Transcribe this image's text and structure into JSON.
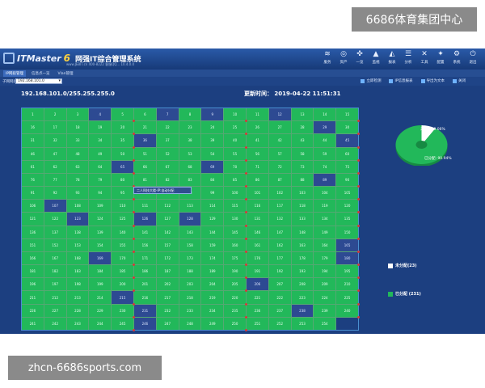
{
  "watermarks": {
    "top": "6686体育集团中心",
    "bottom": "zhcn-6686sports.com"
  },
  "app": {
    "brand": "ITMaster",
    "version": "6",
    "title": "网强IT综合管理系统",
    "subtitle": "www.JEBIT.cn   400-8222  客服QQ...  10.4.0.0"
  },
  "toolbar": [
    {
      "name": "server",
      "label": "服务",
      "icon": "server-icon",
      "glyph": "≋"
    },
    {
      "name": "assets",
      "label": "资产",
      "icon": "assets-icon",
      "glyph": "◎"
    },
    {
      "name": "topology",
      "label": "一览",
      "icon": "topology-icon",
      "glyph": "✜"
    },
    {
      "name": "monitor",
      "label": "监视",
      "icon": "monitor-icon",
      "glyph": "▲"
    },
    {
      "name": "chart",
      "label": "报表",
      "icon": "chart-icon",
      "glyph": "◭"
    },
    {
      "name": "analysis",
      "label": "分析",
      "icon": "analysis-icon",
      "glyph": "☰"
    },
    {
      "name": "tools",
      "label": "工具",
      "icon": "tools-icon",
      "glyph": "✕"
    },
    {
      "name": "settings",
      "label": "配置",
      "icon": "settings-icon",
      "glyph": "✦"
    },
    {
      "name": "system",
      "label": "系统",
      "icon": "system-icon",
      "glyph": "⚙"
    },
    {
      "name": "exit",
      "label": "退出",
      "icon": "exit-icon",
      "glyph": "⏻"
    }
  ],
  "tabs": [
    "IP网段管理",
    "信息点一览",
    "Vlan管理"
  ],
  "filter": {
    "label": "子网网段:",
    "value": "192.168.101.0"
  },
  "actions": [
    "立即检测",
    "IP信息报表",
    "导出为文本",
    "关闭"
  ],
  "subnet": "192.168.101.0/255.255.255.0",
  "update_time": "更新时间： 2019-04-22 11:51:31",
  "tooltip": "二人科技大楼-IP:自动分配",
  "grid": {
    "total": 254,
    "unused": [
      4,
      7,
      9,
      12,
      29,
      36,
      45,
      65,
      69,
      89,
      107,
      123,
      126,
      128,
      165,
      169,
      180,
      206,
      215,
      231,
      238,
      246
    ]
  },
  "chart_data": {
    "type": "pie",
    "categories": [
      "未分配",
      "已分配"
    ],
    "values": [
      23,
      231
    ],
    "labels": [
      "未分配: 9.06%",
      "已分配: 90.94%"
    ],
    "colors": [
      "#ffffff",
      "#22b85a"
    ]
  },
  "legend": [
    {
      "label": "未分配(23)",
      "color": "#ffffff"
    },
    {
      "label": "已分配 (231)",
      "color": "#22b85a"
    }
  ]
}
